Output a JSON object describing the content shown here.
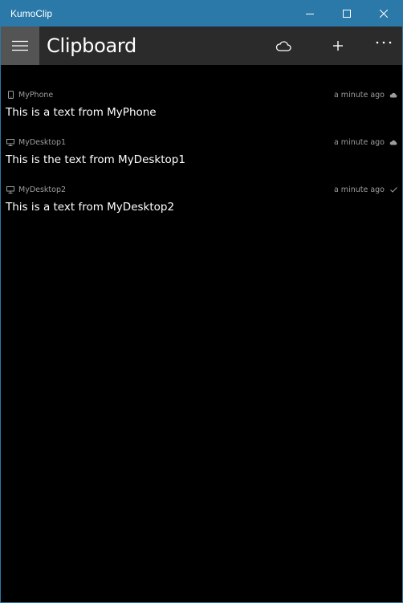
{
  "window": {
    "title": "KumoClip",
    "titlebar_color": "#2b79a8"
  },
  "appbar": {
    "title": "Clipboard",
    "menu_icon": "hamburger-menu-icon",
    "sync_icon": "cloud-icon",
    "add_icon": "plus-icon",
    "more_icon": "more-icon"
  },
  "clips": [
    {
      "device": "MyPhone",
      "device_icon": "phone-icon",
      "time": "a minute ago",
      "status_icon": "cloud-icon",
      "text": "This is a text from MyPhone"
    },
    {
      "device": "MyDesktop1",
      "device_icon": "desktop-icon",
      "time": "a minute ago",
      "status_icon": "cloud-icon",
      "text": "This is the text from MyDesktop1"
    },
    {
      "device": "MyDesktop2",
      "device_icon": "desktop-icon",
      "time": "a minute ago",
      "status_icon": "checkmark-icon",
      "text": "This is a text from MyDesktop2"
    }
  ]
}
